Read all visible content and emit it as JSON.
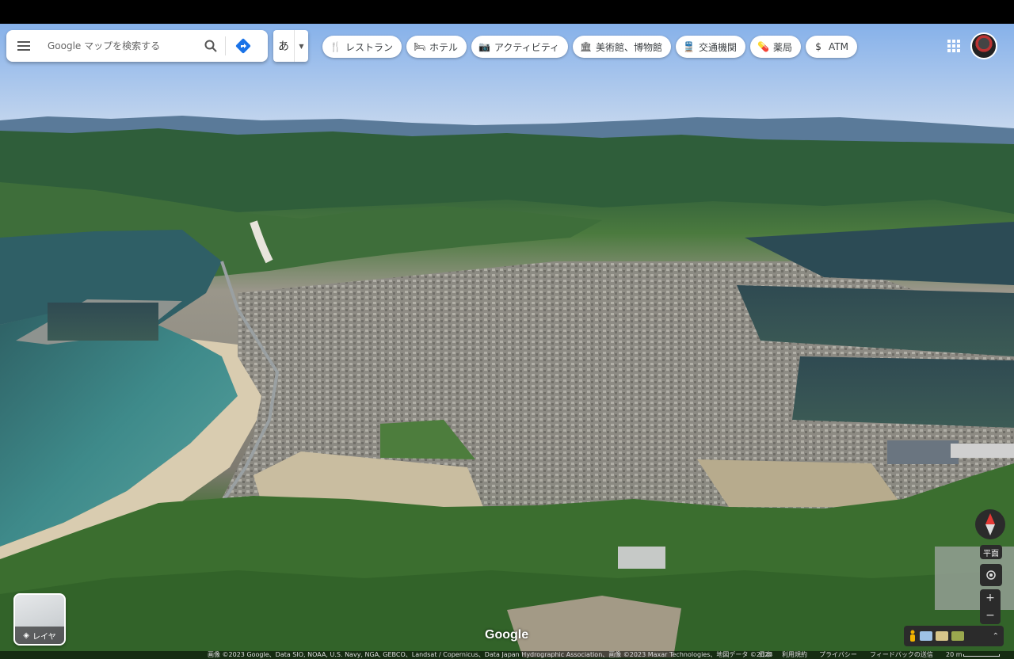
{
  "search": {
    "placeholder": "Google マップを検索する"
  },
  "ime": {
    "char": "あ"
  },
  "chips": [
    {
      "icon": "restaurant-icon",
      "label": "レストラン"
    },
    {
      "icon": "hotel-icon",
      "label": "ホテル"
    },
    {
      "icon": "camera-icon",
      "label": "アクティビティ"
    },
    {
      "icon": "museum-icon",
      "label": "美術館、博物館"
    },
    {
      "icon": "transit-icon",
      "label": "交通機関"
    },
    {
      "icon": "pharmacy-icon",
      "label": "薬局"
    },
    {
      "icon": "atm-icon",
      "label": "ATM"
    }
  ],
  "layer": {
    "label": "レイヤ"
  },
  "controls": {
    "tilt_label": "平面"
  },
  "logo": "Google",
  "footer": {
    "attribution": "画像 ©2023 Google、Data SIO, NOAA, U.S. Navy, NGA, GEBCO、Landsat / Copernicus、Data Japan Hydrographic Association、画像 ©2023 Maxar Technologies、地図データ ©2023",
    "country": "日本",
    "terms": "利用規約",
    "privacy": "プライバシー",
    "feedback": "フィードバックの送信",
    "scale": "20 m"
  },
  "colors": {
    "directions_blue": "#1a73e8"
  }
}
